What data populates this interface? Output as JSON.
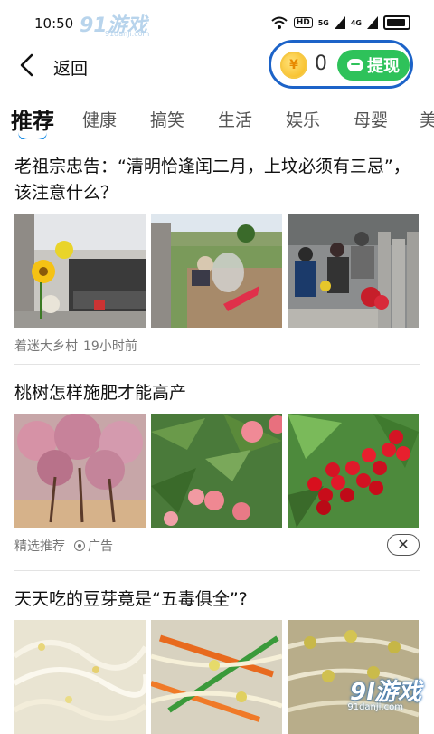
{
  "status_bar": {
    "time": "10:50",
    "hd": "HD",
    "signal1": "5G",
    "signal2": "4G"
  },
  "watermark_top": {
    "main": "91游戏",
    "url": "91danji.com"
  },
  "header": {
    "back_label": "返回",
    "coin_count": "0",
    "withdraw_label": "提现",
    "accent": "#1c63c8",
    "withdraw_color": "#2ec25a"
  },
  "tabs": [
    {
      "label": "推荐",
      "active": true
    },
    {
      "label": "健康"
    },
    {
      "label": "搞笑"
    },
    {
      "label": "生活"
    },
    {
      "label": "娱乐"
    },
    {
      "label": "母婴"
    },
    {
      "label": "美"
    }
  ],
  "articles": [
    {
      "title": "老祖宗忠告：“清明恰逢闰二月，上坟必须有三忌”，该注意什么？",
      "images": [
        "grave-flowers-photo",
        "burning-offerings-photo",
        "cemetery-visitors-photo"
      ],
      "source": "着迷大乡村",
      "time": "19小时前"
    },
    {
      "title": "桃树怎样施肥才能高产",
      "images": [
        "peach-orchard-photo",
        "peach-fruit-photo",
        "cherries-photo"
      ],
      "source": "精选推荐",
      "ad_label": "广告"
    },
    {
      "title": "天天吃的豆芽竟是“五毒俱全”?",
      "images": [
        "bean-sprouts-photo",
        "sprout-stirfry-photo",
        "soybean-sprouts-photo"
      ]
    }
  ],
  "watermark_bottom": {
    "main": "9l游戏",
    "url": "91danji.com"
  }
}
